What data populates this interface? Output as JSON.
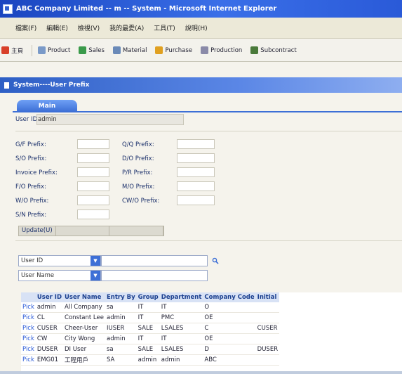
{
  "window": {
    "title": "ABC Company Limited -- m -- System - Microsoft Internet Explorer"
  },
  "menu": [
    "檔案(F)",
    "編輯(E)",
    "檢視(V)",
    "我的最愛(A)",
    "工具(T)",
    "說明(H)"
  ],
  "nav_tabs": [
    {
      "label": "主頁",
      "icon": "home-icon",
      "color": "#d8402a"
    },
    {
      "label": "Product",
      "icon": "product-icon",
      "color": "#7a9ac8"
    },
    {
      "label": "Sales",
      "icon": "sales-icon",
      "color": "#3a9a4a"
    },
    {
      "label": "Material",
      "icon": "material-icon",
      "color": "#6a8ab8"
    },
    {
      "label": "Purchase",
      "icon": "purchase-icon",
      "color": "#e0a020"
    },
    {
      "label": "Production",
      "icon": "production-icon",
      "color": "#8a8aa8"
    },
    {
      "label": "Subcontract",
      "icon": "subcontract-icon",
      "color": "#4a7a3a"
    }
  ],
  "page_header": "System----User Prefix",
  "main_tab": "Main",
  "user_id": {
    "label": "User ID:",
    "value": "admin"
  },
  "prefix_left": [
    "G/F Prefix:",
    "S/O Prefix:",
    "Invoice Prefix:",
    "F/O Prefix:",
    "W/O Prefix:",
    "S/N Prefix:"
  ],
  "prefix_right": [
    "Q/Q Prefix:",
    "D/O Prefix:",
    "P/R Prefix:",
    "M/O Prefix:",
    "CW/O Prefix:"
  ],
  "update_button": "Update(U)",
  "search": {
    "field1": "User ID",
    "field2": "User Name"
  },
  "table": {
    "headers": [
      "",
      "User ID",
      "User Name",
      "Entry By",
      "Group",
      "Department",
      "Company Code",
      "Initial"
    ],
    "rows": [
      [
        "Pick",
        "admin",
        "All Company",
        "sa",
        "IT",
        "IT",
        "O",
        ""
      ],
      [
        "Pick",
        "CL",
        "Constant Lee",
        "admin",
        "IT",
        "PMC",
        "OE",
        ""
      ],
      [
        "Pick",
        "CUSER",
        "Cheer-User",
        "IUSER",
        "SALE",
        "LSALES",
        "C",
        "CUSER"
      ],
      [
        "Pick",
        "CW",
        "City Wong",
        "admin",
        "IT",
        "IT",
        "OE",
        ""
      ],
      [
        "Pick",
        "DUSER",
        "DI User",
        "sa",
        "SALE",
        "LSALES",
        "D",
        "DUSER"
      ],
      [
        "Pick",
        "EMG01",
        "工程用戶",
        "SA",
        "admin",
        "admin",
        "ABC",
        ""
      ]
    ]
  }
}
